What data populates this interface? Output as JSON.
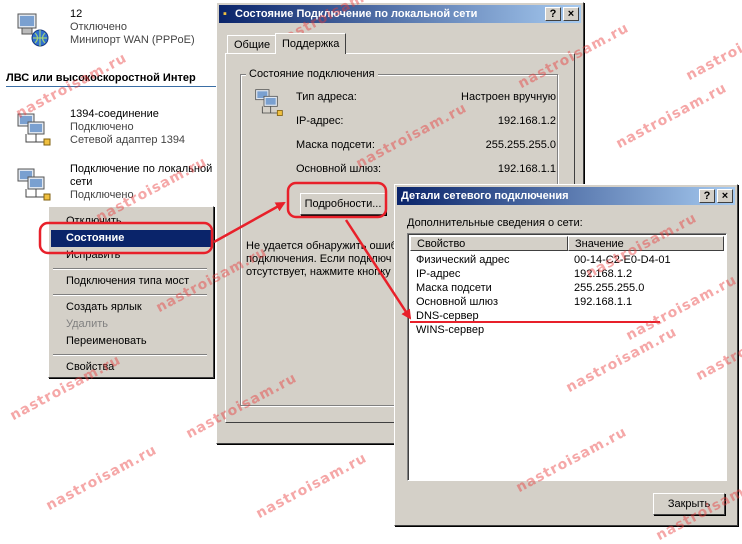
{
  "connections": [
    {
      "name": "12",
      "status": "Отключено",
      "device": "Минипорт WAN (PPPoE)",
      "icon": "globe-network-icon"
    },
    {
      "name": "1394-соединение",
      "status": "Подключено",
      "device": "Сетевой адаптер 1394",
      "icon": "network-computers-icon"
    },
    {
      "name": "Подключение по локальной",
      "name2": "сети",
      "status": "Подключено",
      "icon": "network-computers-icon"
    }
  ],
  "group_header": "ЛВС или высокоскоростной Интер",
  "context_menu": {
    "items": [
      {
        "label": "Отключить",
        "state": "normal"
      },
      {
        "label": "Состояние",
        "state": "highlighted"
      },
      {
        "label": "Исправить",
        "state": "normal"
      },
      {
        "label": "Подключения типа мост",
        "state": "normal"
      },
      {
        "label": "Создать ярлык",
        "state": "normal"
      },
      {
        "label": "Удалить",
        "state": "disabled"
      },
      {
        "label": "Переименовать",
        "state": "normal"
      },
      {
        "label": "Свойства",
        "state": "normal"
      }
    ]
  },
  "status_dialog": {
    "title": "Состояние Подключение по локальной сети",
    "help_btn": "?",
    "close_btn": "×",
    "tabs": [
      "Общие",
      "Поддержка"
    ],
    "active_tab": 1,
    "group_label": "Состояние подключения",
    "fields": [
      {
        "label": "Тип адреса:",
        "value": "Настроен вручную"
      },
      {
        "label": "IP-адрес:",
        "value": "192.168.1.2"
      },
      {
        "label": "Маска подсети:",
        "value": "255.255.255.0"
      },
      {
        "label": "Основной шлюз:",
        "value": "192.168.1.1"
      }
    ],
    "details_button": "Подробности...",
    "info_text": [
      "Не удается обнаружить ошиб",
      "подключения. Если подключ",
      "отсутствует, нажмите кнопку"
    ]
  },
  "details_dialog": {
    "title": "Детали сетевого подключения",
    "help_btn": "?",
    "close_btn": "×",
    "subtitle": "Дополнительные сведения о сети:",
    "columns": [
      "Свойство",
      "Значение"
    ],
    "rows": [
      {
        "prop": "Физический адрес",
        "val": "00-14-C2-E0-D4-01"
      },
      {
        "prop": "IP-адрес",
        "val": "192.168.1.2"
      },
      {
        "prop": "Маска подсети",
        "val": "255.255.255.0"
      },
      {
        "prop": "Основной шлюз",
        "val": "192.168.1.1"
      },
      {
        "prop": "DNS-сервер",
        "val": ""
      },
      {
        "prop": "WINS-сервер",
        "val": ""
      }
    ],
    "close_button": "Закрыть"
  },
  "watermark_text": "nastroisam.ru",
  "colors": {
    "highlight": "#0a246a",
    "annotation": "#e8202a",
    "face": "#d4d0c8"
  }
}
